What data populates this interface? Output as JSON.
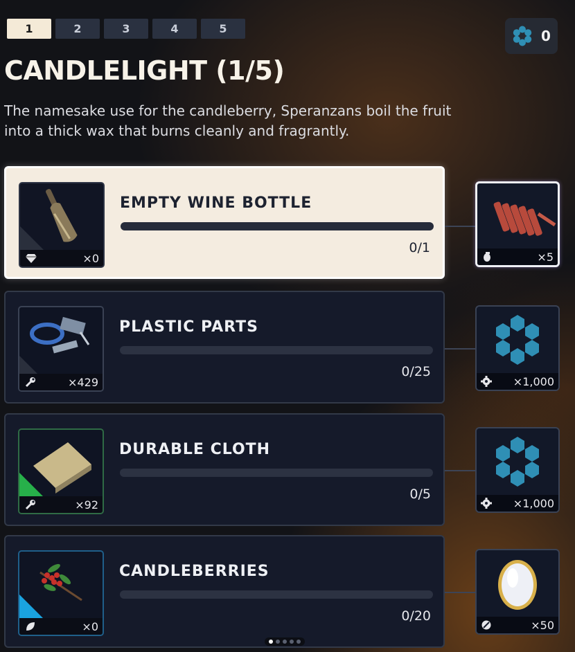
{
  "tabs": [
    "1",
    "2",
    "3",
    "4",
    "5"
  ],
  "active_tab": 0,
  "currency": {
    "icon": "gear-icon",
    "count": "0"
  },
  "title": "CANDLELIGHT (1/5)",
  "description": "The namesake use for the candleberry, Speranzans boil the fruit into a thick wax that burns cleanly and fragrantly.",
  "items": [
    {
      "name": "EMPTY WINE BOTTLE",
      "owned": "×0",
      "progress": "0/1",
      "progress_fraction": 0,
      "category_icon": "gem-icon",
      "item_icon": "wine-bottle-icon",
      "reward": {
        "icon": "dynamite-bundle-icon",
        "type_icon": "grenade-icon",
        "qty": "×5"
      }
    },
    {
      "name": "PLASTIC PARTS",
      "owned": "×429",
      "progress": "0/25",
      "progress_fraction": 0,
      "category_icon": "wrench-icon",
      "item_icon": "plastic-parts-icon",
      "reward": {
        "icon": "hex-ring-icon",
        "type_icon": "gear-icon",
        "qty": "×1,000"
      }
    },
    {
      "name": "DURABLE CLOTH",
      "owned": "×92",
      "progress": "0/5",
      "progress_fraction": 0,
      "category_icon": "wrench-icon",
      "item_icon": "cloth-icon",
      "rarity_color": "#27b04a",
      "reward": {
        "icon": "hex-ring-icon",
        "type_icon": "gear-icon",
        "qty": "×1,000"
      }
    },
    {
      "name": "CANDLEBERRIES",
      "owned": "×0",
      "progress": "0/20",
      "progress_fraction": 0,
      "category_icon": "leaf-icon",
      "item_icon": "candleberry-branch-icon",
      "rarity_color": "#1aa3e0",
      "reward": {
        "icon": "gold-egg-icon",
        "type_icon": "stone-icon",
        "qty": "×50"
      }
    }
  ],
  "pager": {
    "count": 5,
    "active": 0
  },
  "colors": {
    "accent_cream": "#f4ece0",
    "panel": "#151a2a",
    "hex_blue": "#2f8fb5"
  }
}
